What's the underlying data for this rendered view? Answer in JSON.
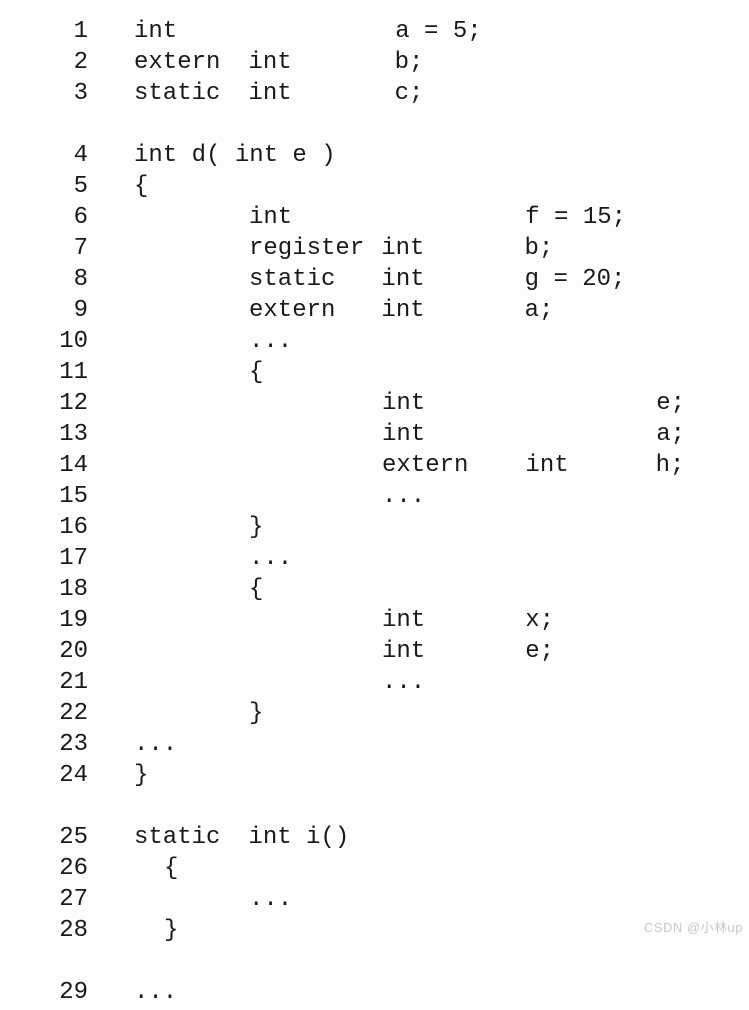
{
  "watermark": "CSDN @小林up",
  "lines": [
    {
      "n": "1",
      "cols": [
        [
          "int",
          0
        ],
        [
          "a = 5;",
          262
        ]
      ]
    },
    {
      "n": "2",
      "cols": [
        [
          "extern",
          0
        ],
        [
          "int",
          115
        ],
        [
          "b;",
          262
        ]
      ]
    },
    {
      "n": "3",
      "cols": [
        [
          "static",
          0
        ],
        [
          "int",
          115
        ],
        [
          "c;",
          262
        ]
      ]
    },
    {
      "gap": true
    },
    {
      "n": "4",
      "cols": [
        [
          "int d( int e )",
          0
        ]
      ]
    },
    {
      "n": "5",
      "cols": [
        [
          "{",
          0
        ]
      ]
    },
    {
      "n": "6",
      "cols": [
        [
          "int",
          115
        ],
        [
          "f = 15;",
          392
        ]
      ]
    },
    {
      "n": "7",
      "cols": [
        [
          "register",
          115
        ],
        [
          "int",
          248
        ],
        [
          "b;",
          392
        ]
      ]
    },
    {
      "n": "8",
      "cols": [
        [
          "static",
          115
        ],
        [
          "int",
          248
        ],
        [
          "g = 20;",
          392
        ]
      ]
    },
    {
      "n": "9",
      "cols": [
        [
          "extern",
          115
        ],
        [
          "int",
          248
        ],
        [
          "a;",
          392
        ]
      ]
    },
    {
      "n": "10",
      "cols": [
        [
          "...",
          115
        ]
      ]
    },
    {
      "n": "11",
      "cols": [
        [
          "{",
          115
        ]
      ]
    },
    {
      "n": "12",
      "cols": [
        [
          "int",
          248
        ],
        [
          "e;",
          523
        ]
      ]
    },
    {
      "n": "13",
      "cols": [
        [
          "int",
          248
        ],
        [
          "a;",
          523
        ]
      ]
    },
    {
      "n": "14",
      "cols": [
        [
          "extern",
          248
        ],
        [
          "int",
          392
        ],
        [
          "h;",
          523
        ]
      ]
    },
    {
      "n": "15",
      "cols": [
        [
          "...",
          248
        ]
      ]
    },
    {
      "n": "16",
      "cols": [
        [
          "}",
          115
        ]
      ]
    },
    {
      "n": "17",
      "cols": [
        [
          "...",
          115
        ]
      ]
    },
    {
      "n": "18",
      "cols": [
        [
          "{",
          115
        ]
      ]
    },
    {
      "n": "19",
      "cols": [
        [
          "int",
          248
        ],
        [
          "x;",
          392
        ]
      ]
    },
    {
      "n": "20",
      "cols": [
        [
          "int",
          248
        ],
        [
          "e;",
          392
        ]
      ]
    },
    {
      "n": "21",
      "cols": [
        [
          "...",
          248
        ]
      ]
    },
    {
      "n": "22",
      "cols": [
        [
          "}",
          115
        ]
      ]
    },
    {
      "n": "23",
      "cols": [
        [
          "...",
          0
        ]
      ]
    },
    {
      "n": "24",
      "cols": [
        [
          "}",
          0
        ]
      ]
    },
    {
      "gap": true
    },
    {
      "n": "25",
      "cols": [
        [
          "static",
          0
        ],
        [
          "int  i()",
          115
        ]
      ]
    },
    {
      "n": "26",
      "cols": [
        [
          "{",
          30
        ]
      ]
    },
    {
      "n": "27",
      "cols": [
        [
          "...",
          115
        ]
      ]
    },
    {
      "n": "28",
      "cols": [
        [
          "}",
          30
        ]
      ]
    },
    {
      "gap": true
    },
    {
      "n": "29",
      "cols": [
        [
          "...",
          0
        ]
      ]
    }
  ]
}
